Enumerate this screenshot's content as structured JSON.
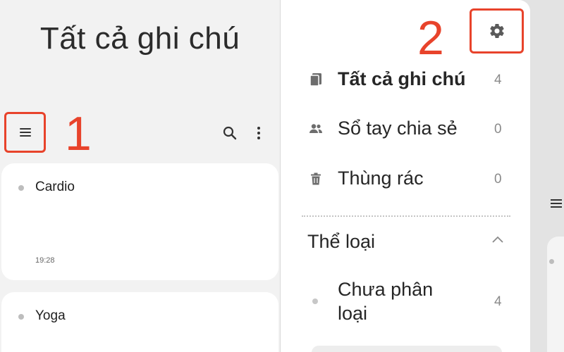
{
  "left": {
    "app_title": "Tất cả ghi chú",
    "menu_icon": "hamburger-menu-icon",
    "search_icon": "search-icon",
    "more_icon": "more-vert-icon",
    "notes": [
      {
        "title": "Cardio",
        "time": "19:28"
      },
      {
        "title": "Yoga"
      }
    ]
  },
  "annotations": {
    "step1": "1",
    "step2": "2",
    "color": "#e8432b"
  },
  "drawer": {
    "settings_icon": "gear-icon",
    "items": [
      {
        "icon": "notes-stack-icon",
        "label": "Tất cả ghi chú",
        "count": "4"
      },
      {
        "icon": "people-icon",
        "label": "Sổ tay chia sẻ",
        "count": "0"
      },
      {
        "icon": "trash-icon",
        "label": "Thùng rác",
        "count": "0"
      }
    ],
    "category_header": "Thể loại",
    "category_chevron": "chevron-up-icon",
    "categories": [
      {
        "label": "Chưa phân loại",
        "count": "4"
      }
    ]
  }
}
